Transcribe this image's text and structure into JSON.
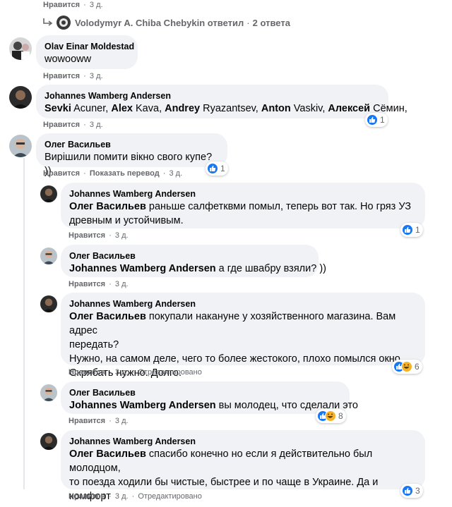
{
  "top_meta": {
    "like": "Нравится",
    "dot": "·",
    "time": "3 д."
  },
  "reply_link": {
    "text": "Volodymyr A. Chiba Chebykin ответил",
    "dot": "·",
    "count": "2 ответа"
  },
  "comments": [
    {
      "author": "Olav Einar Moldestad",
      "text": "wowooww",
      "like": "Нравится",
      "time": "3 д."
    },
    {
      "author": "Johannes Wamberg Andersen",
      "tags": [
        {
          "bold": "Sevki",
          "rest": " Acuner, "
        },
        {
          "bold": "Alex",
          "rest": " Kava, "
        },
        {
          "bold": "Andrey",
          "rest": " Ryazantsev, "
        },
        {
          "bold": "Anton",
          "rest": " Vaskiv, "
        },
        {
          "bold": "Алексей",
          "rest": " Сёмин,"
        }
      ],
      "like": "Нравится",
      "time": "3 д.",
      "reaction_count": "1"
    },
    {
      "author": "Олег Васильев",
      "text": "Вирішили помити вікно свого купе? ))",
      "like": "Нравится",
      "translate": "Показать перевод",
      "time": "3 д.",
      "reaction_count": "1"
    }
  ],
  "replies": [
    {
      "author": "Johannes Wamberg Andersen",
      "mention": "Олег Васильев",
      "text_line1": " раньше салфеткв­ми помыл, теперь вот так. Но гряз УЗ",
      "text_line2": "древным и устойчивым.",
      "like": "Нравится",
      "time": "3 д.",
      "reaction_count": "1"
    },
    {
      "author": "Олег Васильев",
      "mention": "Johannes Wamberg Andersen",
      "text_line1": " а где швабру взяли? ))",
      "like": "Нравится",
      "time": "3 д."
    },
    {
      "author": "Johannes Wamberg Andersen",
      "mention": "Олег Васильев",
      "text_line1": " покупали накануне у хозяйственного магазина. Вам адрес",
      "text_line2": "передать?",
      "text_line3": "Нужно, на самом деле, чего то более жестокого, плохо помылся окно.",
      "text_line4": "Скрябать нужно. Долго.",
      "like": "Нравится",
      "time": "3 д.",
      "edited": "Отредактировано",
      "reaction_count": "6"
    },
    {
      "author": "Олег Васильев",
      "mention": "Johannes Wamberg Andersen",
      "text_line1": " вы молодец, что сделали это",
      "like": "Нравится",
      "time": "3 д.",
      "reaction_count": "8"
    },
    {
      "author": "Johannes Wamberg Andersen",
      "mention": "Олег Васильев",
      "text_line1": " спасибо конечно но если я действительно был молодцом,",
      "text_line2": "то поезда ходили бы чистые, быстрее и по чаще в Украине. Да и комфорт",
      "text_line3": "...",
      "like": "Нравится",
      "time": "3 д.",
      "edited": "Отредактировано",
      "reaction_count": "3"
    }
  ],
  "icons": {
    "like": "like-icon",
    "haha": "haha-icon",
    "reply_arrow": "reply-arrow-icon"
  },
  "colors": {
    "like_blue": "#1877f2",
    "haha_yellow": "#f7b125",
    "bubble": "#f0f2f5",
    "meta_gray": "#65676b"
  }
}
